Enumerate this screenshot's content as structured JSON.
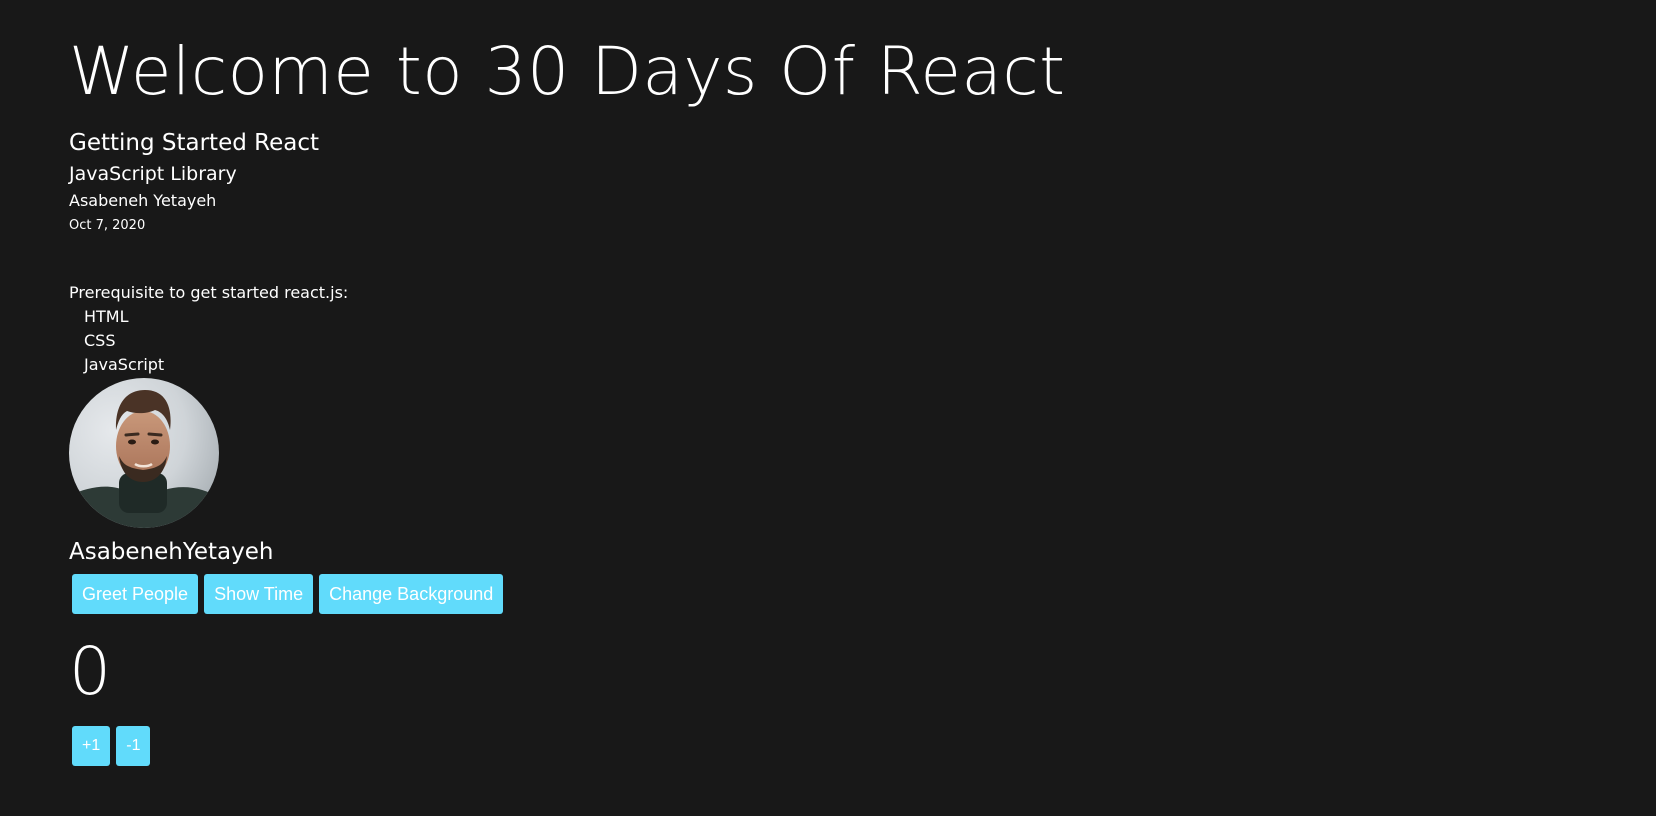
{
  "header": {
    "title": "Welcome to 30 Days Of React",
    "subtitle": "Getting Started React",
    "library": "JavaScript Library",
    "author": "Asabeneh Yetayeh",
    "date": "Oct 7, 2020"
  },
  "main": {
    "prerequisite_title": "Prerequisite to get started react.js:",
    "prerequisites": [
      "HTML",
      "CSS",
      "JavaScript"
    ],
    "user_card": {
      "name": "AsabenehYetayeh"
    },
    "buttons": {
      "greet_label": "Greet People",
      "show_time_label": "Show Time",
      "change_background_label": "Change Background"
    },
    "counter": {
      "count": "0",
      "increment_label": "+1",
      "decrement_label": "-1"
    }
  },
  "colors": {
    "background": "#181818",
    "text": "#ffffff",
    "button": "#61dbfb"
  }
}
